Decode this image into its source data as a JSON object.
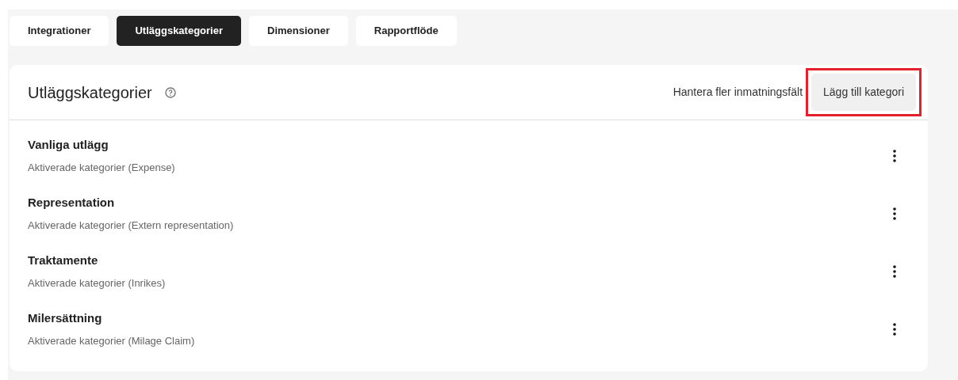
{
  "tabs": [
    {
      "label": "Integrationer",
      "selected": false
    },
    {
      "label": "Utläggskategorier",
      "selected": true
    },
    {
      "label": "Dimensioner",
      "selected": false
    },
    {
      "label": "Rapportflöde",
      "selected": false
    }
  ],
  "panel": {
    "title": "Utläggskategorier",
    "manage_link": "Hantera fler inmatningsfält",
    "add_button": {
      "label": "Lägg till kategori",
      "highlighted": true
    }
  },
  "categories": [
    {
      "name": "Vanliga utlägg",
      "description": "Aktiverade kategorier (Expense)"
    },
    {
      "name": "Representation",
      "description": "Aktiverade kategorier (Extern representation)"
    },
    {
      "name": "Traktamente",
      "description": "Aktiverade kategorier (Inrikes)"
    },
    {
      "name": "Milersättning",
      "description": "Aktiverade kategorier (Milage Claim)"
    }
  ]
}
